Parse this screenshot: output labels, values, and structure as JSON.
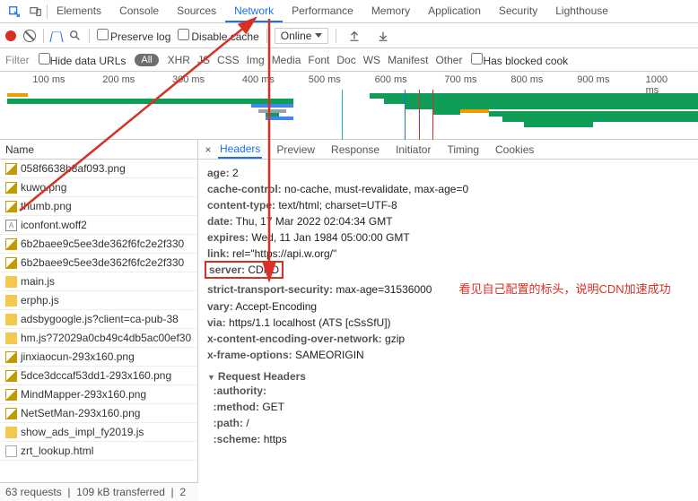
{
  "tabs": [
    "Elements",
    "Console",
    "Sources",
    "Network",
    "Performance",
    "Memory",
    "Application",
    "Security",
    "Lighthouse"
  ],
  "active_tab": "Network",
  "toolbar2": {
    "preserve_log": "Preserve log",
    "disable_cache": "Disable cache",
    "throttle": "Online"
  },
  "filterbar": {
    "placeholder": "Filter",
    "hide_data_urls": "Hide data URLs",
    "all": "All",
    "types": [
      "XHR",
      "JS",
      "CSS",
      "Img",
      "Media",
      "Font",
      "Doc",
      "WS",
      "Manifest",
      "Other"
    ],
    "blocked": "Has blocked cook"
  },
  "timeline_ticks": [
    "100 ms",
    "200 ms",
    "300 ms",
    "400 ms",
    "500 ms",
    "600 ms",
    "700 ms",
    "800 ms",
    "900 ms",
    "1000 ms"
  ],
  "name_header": "Name",
  "detail_tabs": [
    "Headers",
    "Preview",
    "Response",
    "Initiator",
    "Timing",
    "Cookies"
  ],
  "files": [
    {
      "icon": "img",
      "name": "058f6638b8af093.png"
    },
    {
      "icon": "img",
      "name": "kuwo.png"
    },
    {
      "icon": "img",
      "name": "thumb.png"
    },
    {
      "icon": "font",
      "name": "iconfont.woff2"
    },
    {
      "icon": "img",
      "name": "6b2baee9c5ee3de362f6fc2e2f330"
    },
    {
      "icon": "img",
      "name": "6b2baee9c5ee3de362f6fc2e2f330"
    },
    {
      "icon": "js",
      "name": "main.js"
    },
    {
      "icon": "js",
      "name": "erphp.js"
    },
    {
      "icon": "js",
      "name": "adsbygoogle.js?client=ca-pub-38"
    },
    {
      "icon": "js",
      "name": "hm.js?72029a0cb49c4db5ac00ef30"
    },
    {
      "icon": "img",
      "name": "jinxiaocun-293x160.png"
    },
    {
      "icon": "img",
      "name": "5dce3dccaf53dd1-293x160.png"
    },
    {
      "icon": "img",
      "name": "MindMapper-293x160.png"
    },
    {
      "icon": "img",
      "name": "NetSetMan-293x160.png"
    },
    {
      "icon": "js",
      "name": "show_ads_impl_fy2019.js"
    },
    {
      "icon": "doc",
      "name": "zrt_lookup.html"
    }
  ],
  "status": {
    "requests": "63 requests",
    "transferred": "109 kB transferred",
    "extra": "2"
  },
  "headers": [
    {
      "k": "age",
      "v": "2"
    },
    {
      "k": "cache-control",
      "v": "no-cache, must-revalidate, max-age=0"
    },
    {
      "k": "content-type",
      "v": "text/html; charset=UTF-8"
    },
    {
      "k": "date",
      "v": "Thu, 17 Mar 2022 02:04:34 GMT"
    },
    {
      "k": "expires",
      "v": "Wed, 11 Jan 1984 05:00:00 GMT"
    },
    {
      "k": "link",
      "v": "rel=\"https://api.w.org/\""
    },
    {
      "k": "server",
      "v": "CDND"
    },
    {
      "k": "strict-transport-security",
      "v": "max-age=31536000"
    },
    {
      "k": "vary",
      "v": "Accept-Encoding"
    },
    {
      "k": "via",
      "v": "https/1.1 localhost (ATS [cSsSfU])"
    },
    {
      "k": "x-content-encoding-over-network",
      "v": "gzip"
    },
    {
      "k": "x-frame-options",
      "v": "SAMEORIGIN"
    }
  ],
  "request_headers_title": "Request Headers",
  "req_headers": [
    {
      "k": ":authority:",
      "v": ""
    },
    {
      "k": ":method:",
      "v": "GET"
    },
    {
      "k": ":path:",
      "v": "/"
    },
    {
      "k": ":scheme:",
      "v": "https"
    }
  ],
  "annotation": "看见自己配置的标头，说明CDN加速成功"
}
